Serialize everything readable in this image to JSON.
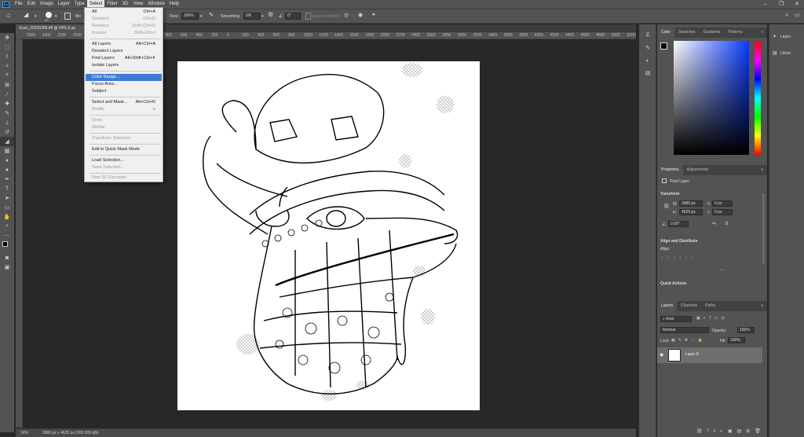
{
  "menubar": {
    "logo": "Ps",
    "items": [
      {
        "label": "File"
      },
      {
        "label": "Edit"
      },
      {
        "label": "Image"
      },
      {
        "label": "Layer"
      },
      {
        "label": "Type"
      },
      {
        "label": "Select"
      },
      {
        "label": "Filter"
      },
      {
        "label": "3D"
      },
      {
        "label": "View"
      },
      {
        "label": "Window"
      },
      {
        "label": "Help"
      }
    ]
  },
  "options": {
    "brush_size": "20",
    "mode_label": "Mo",
    "flow_label": "Flow:",
    "flow_value": "100%",
    "smoothing_label": "Smoothing:",
    "smoothing_value": "0%",
    "angle_value": "0°",
    "erase_history": "Erase to History"
  },
  "document": {
    "tab_title": "Scan_20220306.tiff @ 24% (Lay",
    "zoom": "24%",
    "dimensions": "3986 px x 4625 px (300.009 ppi)"
  },
  "ruler_top": [
    "2600",
    "2400",
    "2200",
    "2000",
    "1800",
    "1600",
    "1400",
    "1200",
    "1000",
    "800",
    "600",
    "400",
    "200",
    "0",
    "200",
    "400",
    "600",
    "800",
    "1000",
    "1200",
    "1400",
    "1600",
    "1800",
    "2000",
    "2200",
    "2400",
    "2600",
    "2800",
    "3000",
    "3200",
    "3400",
    "3600",
    "3800",
    "4000",
    "4200",
    "4400",
    "4600",
    "4800",
    "5000",
    "5200"
  ],
  "select_menu": {
    "items": [
      {
        "label": "All",
        "shortcut": "Ctrl+A"
      },
      {
        "label": "Deselect",
        "shortcut": "Ctrl+D"
      },
      {
        "label": "Reselect",
        "shortcut": "Shift+Ctrl+D"
      },
      {
        "label": "Inverse",
        "shortcut": "Shift+Ctrl+I"
      },
      {
        "label": "All Layers",
        "shortcut": "Alt+Ctrl+A"
      },
      {
        "label": "Deselect Layers",
        "shortcut": ""
      },
      {
        "label": "Find Layers",
        "shortcut": "Alt+Shift+Ctrl+F"
      },
      {
        "label": "Isolate Layers",
        "shortcut": ""
      },
      {
        "label": "Color Range...",
        "shortcut": ""
      },
      {
        "label": "Focus Area...",
        "shortcut": ""
      },
      {
        "label": "Subject",
        "shortcut": ""
      },
      {
        "label": "Select and Mask...",
        "shortcut": "Alt+Ctrl+R"
      },
      {
        "label": "Modify",
        "shortcut": "▸"
      },
      {
        "label": "Grow",
        "shortcut": ""
      },
      {
        "label": "Similar",
        "shortcut": ""
      },
      {
        "label": "Transform Selection",
        "shortcut": ""
      },
      {
        "label": "Edit in Quick Mask Mode",
        "shortcut": ""
      },
      {
        "label": "Load Selection...",
        "shortcut": ""
      },
      {
        "label": "Save Selection...",
        "shortcut": ""
      },
      {
        "label": "New 3D Extrusion",
        "shortcut": ""
      }
    ]
  },
  "color_panel": {
    "tabs": [
      {
        "label": "Color"
      },
      {
        "label": "Swatches"
      },
      {
        "label": "Gradients"
      },
      {
        "label": "Patterns"
      }
    ]
  },
  "properties_panel": {
    "tabs": [
      {
        "label": "Properties"
      },
      {
        "label": "Adjustments"
      }
    ],
    "layer_kind": "Pixel Layer",
    "transform_title": "Transform",
    "w_label": "W",
    "w_value": "3986 px",
    "h_label": "H",
    "h_value": "4625 px",
    "x_label": "X",
    "x_value": "0 px",
    "y_label": "Y",
    "y_value": "0 px",
    "angle_value": "0.00°",
    "align_title": "Align and Distribute",
    "align_label": "Align:",
    "quick_actions": "Quick Actions"
  },
  "layers_panel": {
    "tabs": [
      {
        "label": "Layers"
      },
      {
        "label": "Channels"
      },
      {
        "label": "Paths"
      }
    ],
    "kind": "Kind",
    "blend_mode": "Normal",
    "opacity_label": "Opacity:",
    "opacity_value": "100%",
    "lock_label": "Lock:",
    "fill_label": "Fill:",
    "fill_value": "100%",
    "layer_name": "Layer 0"
  },
  "learn_panel": {
    "items": [
      {
        "label": "Learn"
      },
      {
        "label": "Librar..."
      }
    ]
  },
  "colors": {
    "ui_bg": "#535353",
    "workspace": "#282828",
    "highlight": "#3d7bd6"
  }
}
